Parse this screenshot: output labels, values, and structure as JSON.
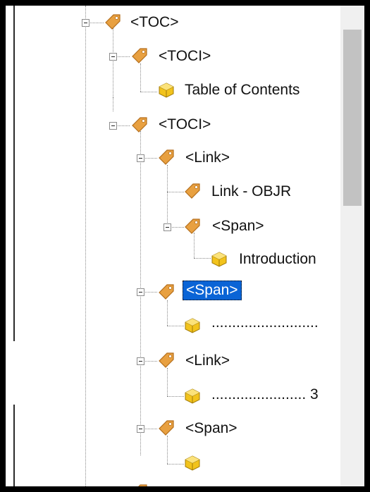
{
  "tree": {
    "nodes": [
      {
        "id": "toc",
        "label": "<TOC>",
        "type": "tag"
      },
      {
        "id": "toci1",
        "label": "<TOCI>",
        "type": "tag"
      },
      {
        "id": "toc-text",
        "label": "Table of Contents",
        "type": "content"
      },
      {
        "id": "toci2",
        "label": "<TOCI>",
        "type": "tag"
      },
      {
        "id": "link1",
        "label": "<Link>",
        "type": "tag"
      },
      {
        "id": "link-objr",
        "label": "Link - OBJR",
        "type": "tag"
      },
      {
        "id": "span1",
        "label": "<Span>",
        "type": "tag"
      },
      {
        "id": "intro",
        "label": "Introduction",
        "type": "content"
      },
      {
        "id": "span2",
        "label": "<Span>",
        "type": "tag",
        "selected": true
      },
      {
        "id": "dots1",
        "label": "..........................",
        "type": "content"
      },
      {
        "id": "link2",
        "label": "<Link>",
        "type": "tag"
      },
      {
        "id": "dots2",
        "label": "....................... 3",
        "type": "content"
      },
      {
        "id": "span3",
        "label": "<Span>",
        "type": "tag"
      },
      {
        "id": "empty",
        "label": "",
        "type": "content"
      }
    ]
  },
  "colors": {
    "selection": "#0a64d6",
    "tag_icon": "#e8a040",
    "content_icon": "#f2c31c"
  }
}
